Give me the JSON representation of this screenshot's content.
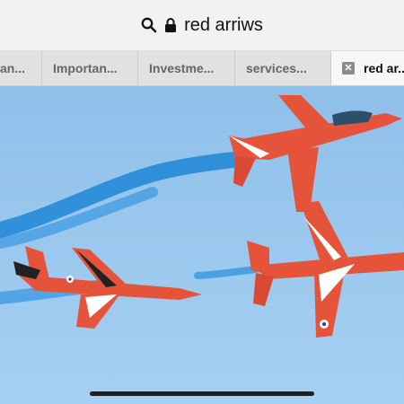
{
  "address_bar": {
    "query": "red arriws",
    "search_icon": "search-icon",
    "lock_icon": "lock-icon"
  },
  "tabs": [
    {
      "label": "an..."
    },
    {
      "label": "Importan..."
    },
    {
      "label": "Investme..."
    },
    {
      "label": "services..."
    },
    {
      "label": "red ar..",
      "active": true,
      "close_icon": "close-icon"
    }
  ],
  "colors": {
    "sky": "#94c3ea",
    "jet_red": "#e5533b",
    "smoke_blue": "#1f7fd0",
    "accent_dark": "#1a1a1a"
  },
  "content": {
    "image_subject": "Red Arrows jets flying in formation with blue smoke trails"
  }
}
